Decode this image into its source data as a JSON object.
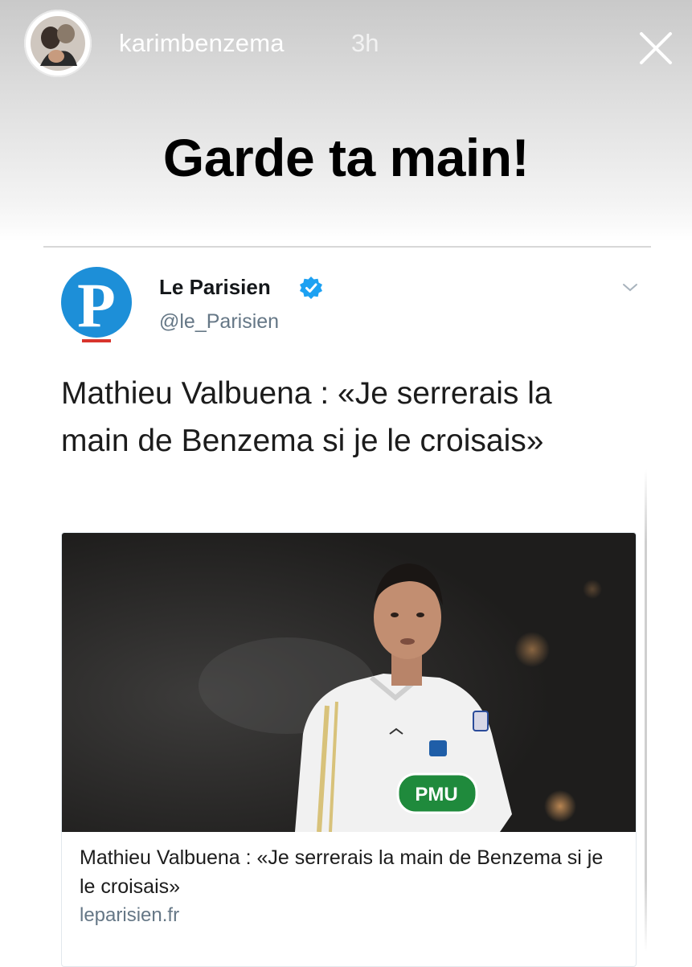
{
  "story": {
    "username": "karimbenzema",
    "time": "3h",
    "caption": "Garde ta main!"
  },
  "tweet": {
    "display_name": "Le Parisien",
    "handle": "@le_Parisien",
    "text": "Mathieu Valbuena : «Je serrerais la main de Benzema si je le croisais»",
    "logo_letter": "P",
    "link_card": {
      "title": "Mathieu Valbuena : «Je serrerais la main de Benzema si je le croisais»",
      "domain": "leparisien.fr",
      "jersey_sponsor": "PMU"
    }
  },
  "icons": {
    "close": "close-icon",
    "verified": "verified-badge-icon",
    "chevron": "chevron-down-icon"
  },
  "colors": {
    "verified_blue": "#1da1f2",
    "parisien_blue": "#1d8fd8",
    "sponsor_green": "#1f8a3c"
  }
}
